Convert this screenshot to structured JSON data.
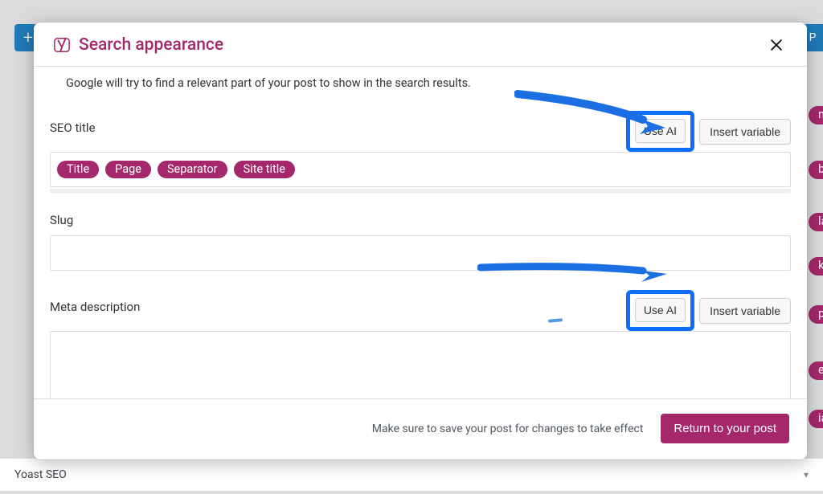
{
  "background": {
    "add_block": "+",
    "publish_label": "P",
    "right_items": [
      "m S",
      "bilit",
      "late",
      "king",
      "perf",
      "ear",
      "ia a"
    ],
    "bottom_panel": {
      "title": "Yoast SEO",
      "arrow": "▾"
    }
  },
  "modal": {
    "title": "Search appearance",
    "close_label": "Close",
    "helper_text": "Google will try to find a relevant part of your post to show in the search results.",
    "seo_title": {
      "label": "SEO title",
      "use_ai": "Use AI",
      "insert_variable": "Insert variable",
      "chips": [
        "Title",
        "Page",
        "Separator",
        "Site title"
      ]
    },
    "slug": {
      "label": "Slug",
      "value": ""
    },
    "meta_description": {
      "label": "Meta description",
      "use_ai": "Use AI",
      "insert_variable": "Insert variable",
      "value": ""
    },
    "footer": {
      "hint": "Make sure to save your post for changes to take effect",
      "primary": "Return to your post"
    }
  }
}
